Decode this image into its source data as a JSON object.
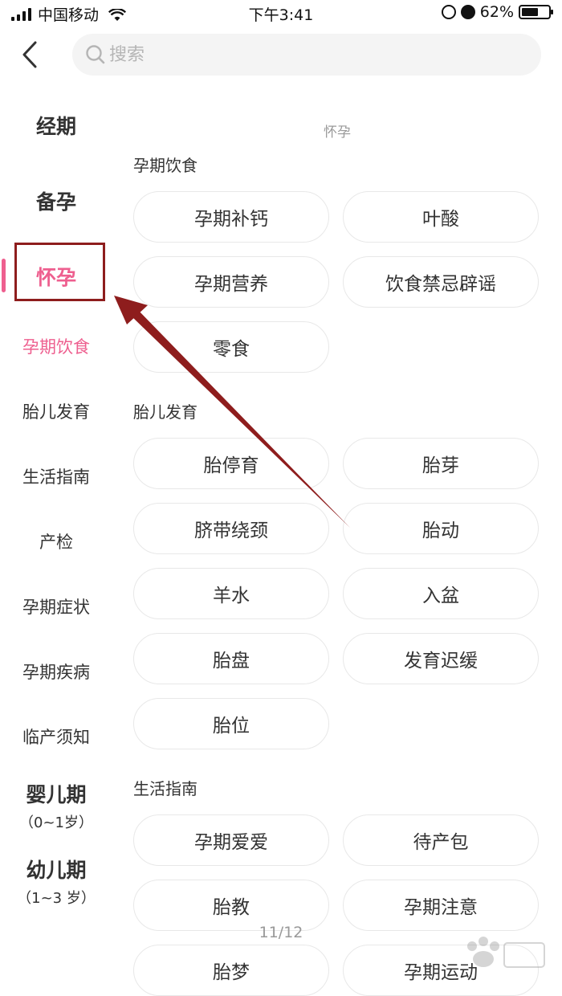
{
  "status_bar": {
    "carrier": "中国移动",
    "time": "下午3:41",
    "battery_percent": "62%",
    "battery_level": 0.62
  },
  "search": {
    "placeholder": "搜索"
  },
  "sidebar": {
    "items": [
      {
        "label": "经期",
        "sub": ""
      },
      {
        "label": "备孕",
        "sub": ""
      },
      {
        "label": "怀孕",
        "sub": ""
      },
      {
        "label": "孕期饮食",
        "sub": ""
      },
      {
        "label": "胎儿发育",
        "sub": ""
      },
      {
        "label": "生活指南",
        "sub": ""
      },
      {
        "label": "产检",
        "sub": ""
      },
      {
        "label": "孕期症状",
        "sub": ""
      },
      {
        "label": "孕期疾病",
        "sub": ""
      },
      {
        "label": "临产须知",
        "sub": ""
      },
      {
        "label": "婴儿期",
        "sub": "（0~1岁）"
      },
      {
        "label": "幼儿期",
        "sub": "（1~3 岁）"
      }
    ]
  },
  "content": {
    "title": "怀孕",
    "sections": [
      {
        "title": "孕期饮食",
        "tags": [
          "孕期补钙",
          "叶酸",
          "孕期营养",
          "饮食禁忌辟谣",
          "零食"
        ]
      },
      {
        "title": "胎儿发育",
        "tags": [
          "胎停育",
          "胎芽",
          "脐带绕颈",
          "胎动",
          "羊水",
          "入盆",
          "胎盘",
          "发育迟缓",
          "胎位"
        ]
      },
      {
        "title": "生活指南",
        "tags": [
          "孕期爱爱",
          "待产包",
          "胎教",
          "孕期注意",
          "胎梦",
          "孕期运动"
        ]
      }
    ]
  },
  "pager": {
    "text": "11/12"
  },
  "colors": {
    "accent": "#ee5f8f",
    "annotation": "#8e1d1d"
  }
}
